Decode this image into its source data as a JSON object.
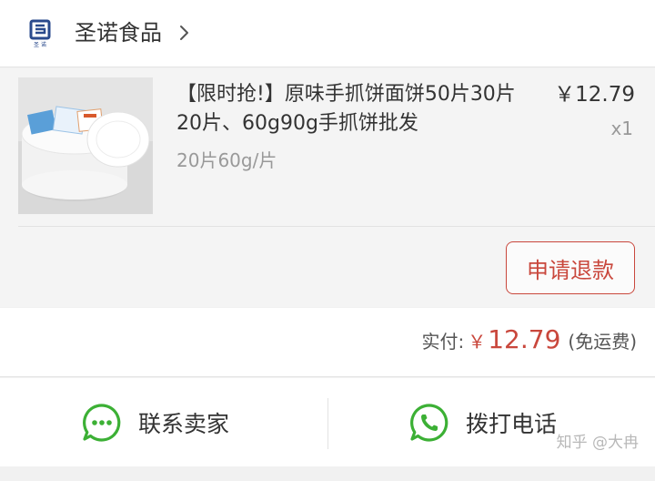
{
  "store": {
    "name": "圣诺食品",
    "logo_text": "圣诺",
    "logo_color": "#2a4a8c"
  },
  "item": {
    "title": "【限时抢!】原味手抓饼面饼50片30片20片、60g90g手抓饼批发",
    "spec": "20片60g/片",
    "price": "￥12.79",
    "quantity": "x1"
  },
  "refund_button": "申请退款",
  "payment": {
    "label": "实付:",
    "currency": "￥",
    "amount": "12.79",
    "note": "(免运费)"
  },
  "actions": {
    "contact_seller": "联系卖家",
    "call_phone": "拨打电话"
  },
  "watermark": "知乎 @大冉",
  "colors": {
    "accent": "#c9473c",
    "wechat_green": "#3cb035"
  },
  "icons": {
    "contact": "chat-bubble-icon",
    "call": "phone-icon",
    "store_nav": "chevron-right-icon"
  }
}
